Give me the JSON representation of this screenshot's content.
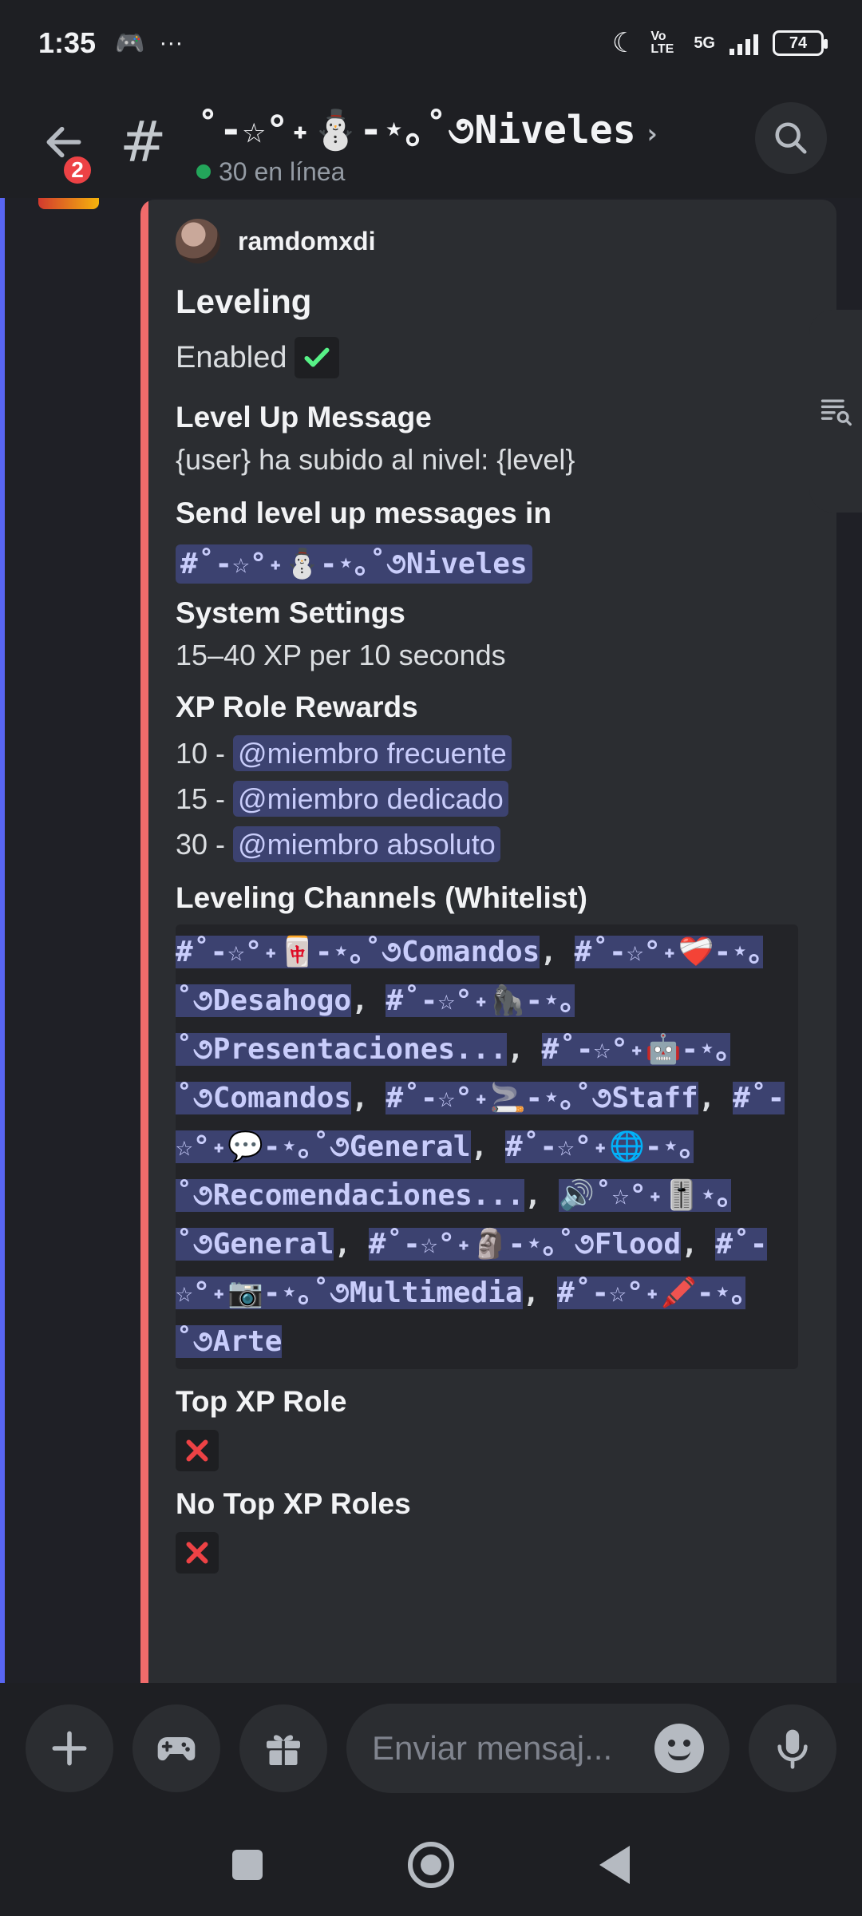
{
  "status_bar": {
    "time": "1:35",
    "dots": "···",
    "network": "5G",
    "volte": "Vo LTE",
    "battery": "74"
  },
  "header": {
    "back_badge": "2",
    "hash": "#",
    "channel_title": "˚-☆°˖⛄-⋆｡˚૭Niveles",
    "chevron": "›",
    "online_status": "30 en línea"
  },
  "embed": {
    "author": "ramdomxdi",
    "title": "Leveling",
    "enabled_label": "Enabled",
    "fields": {
      "level_up_message": {
        "name": "Level Up Message",
        "value": "{user} ha subido al nivel: {level}"
      },
      "send_in": {
        "name": "Send level up messages in",
        "value": "#˚-☆°˖⛄-⋆｡˚૭Niveles"
      },
      "system_settings": {
        "name": "System Settings",
        "value": "15–40 XP per 10 seconds"
      },
      "role_rewards": {
        "name": "XP Role Rewards",
        "items": [
          {
            "level": "10 - ",
            "role": "@miembro frecuente"
          },
          {
            "level": "15 - ",
            "role": "@miembro dedicado"
          },
          {
            "level": "30 - ",
            "role": "@miembro absoluto"
          }
        ]
      },
      "leveling_channels": {
        "name": "Leveling Channels (Whitelist)",
        "channels": [
          "#˚-☆°˖🀄-⋆｡˚૭Comandos",
          "#˚-☆°˖❤️‍🩹-⋆｡˚૭Desahogo",
          "#˚-☆°˖🦍-⋆｡˚૭Presentaciones...",
          "#˚-☆°˖🤖-⋆｡˚૭Comandos",
          "#˚-☆°˖🚬-⋆｡˚૭Staff",
          "#˚-☆°˖💬-⋆｡˚૭General",
          "#˚-☆°˖🌐-⋆｡˚૭Recomendaciones...",
          "🔊˚☆°˖🎚️⋆｡˚૭General",
          "#˚-☆°˖🗿-⋆｡˚૭Flood",
          "#˚-☆°˖📷-⋆｡˚૭Multimedia",
          "#˚-☆°˖🖍️-⋆｡˚૭Arte"
        ],
        "separator": ", "
      },
      "top_xp_role": {
        "name": "Top XP Role"
      },
      "no_top_xp_roles": {
        "name": "No Top XP Roles"
      }
    }
  },
  "composer": {
    "placeholder": "Enviar mensaj..."
  },
  "colors": {
    "accent": "#5865f2",
    "embed_stripe": "#f06b6b",
    "mention_bg": "#3c4270",
    "mention_text": "#c9cdfb",
    "online": "#23a55a",
    "badge": "#ed4245",
    "check": "#57f287",
    "cross": "#ed4245"
  },
  "icons": {
    "back": "arrow-left-icon",
    "search": "search-icon",
    "threads": "thread-list-icon",
    "plus": "plus-icon",
    "games": "gamepad-icon",
    "gift": "gift-icon",
    "emoji": "emoji-icon",
    "mic": "microphone-icon"
  }
}
